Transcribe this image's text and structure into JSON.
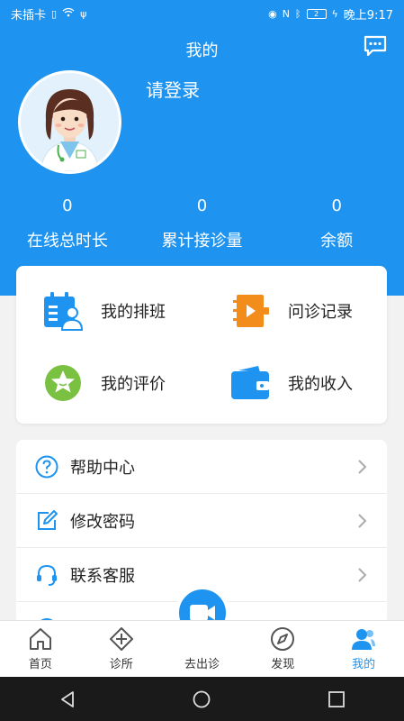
{
  "status_bar": {
    "carrier": "未插卡",
    "battery": "2",
    "time": "晚上9:17"
  },
  "header": {
    "title": "我的",
    "login_text": "请登录"
  },
  "stats": [
    {
      "value": "0",
      "label": "在线总时长"
    },
    {
      "value": "0",
      "label": "累计接诊量"
    },
    {
      "value": "0",
      "label": "余额"
    }
  ],
  "grid": {
    "schedule": "我的排班",
    "consult_records": "问诊记录",
    "reviews": "我的评价",
    "income": "我的收入"
  },
  "menu": {
    "help": "帮助中心",
    "change_password": "修改密码",
    "contact_service": "联系客服"
  },
  "tabs": {
    "home": "首页",
    "clinic": "诊所",
    "visit": "去出诊",
    "discover": "发现",
    "mine": "我的"
  },
  "colors": {
    "primary": "#1e94f0",
    "orange": "#f28c1a",
    "green": "#7ac142"
  }
}
